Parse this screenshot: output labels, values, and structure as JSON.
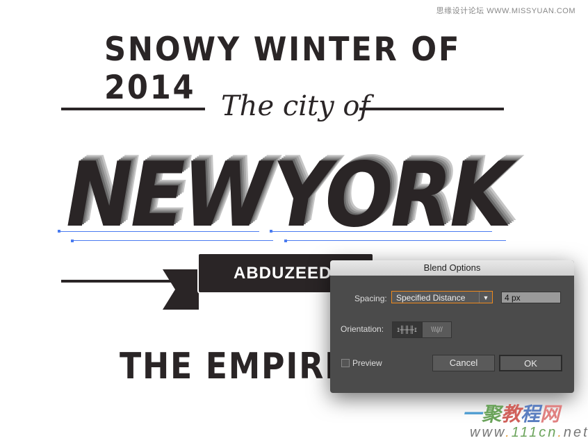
{
  "watermarks": {
    "top": "思缘设计论坛  WWW.MISSYUAN.COM",
    "bottom_cn": [
      "一",
      "聚",
      "教",
      "程",
      "网"
    ],
    "bottom_url_parts": [
      "www",
      ".",
      "111cn",
      ".",
      "net"
    ]
  },
  "artwork": {
    "title": "SNOWY WINTER OF 2014",
    "script": "The city of",
    "headline_left": "NEW",
    "headline_right": "YORK",
    "banner": "ABDUZEEDO",
    "bottom": "THE EMPIRE"
  },
  "dialog": {
    "title": "Blend Options",
    "spacing_label": "Spacing:",
    "spacing_value": "Specified Distance",
    "distance_value": "4 px",
    "orientation_label": "Orientation:",
    "orientation_options": [
      "align-to-page",
      "align-to-path"
    ],
    "orientation_selected": "align-to-page",
    "preview_label": "Preview",
    "preview_checked": false,
    "cancel_label": "Cancel",
    "ok_label": "OK",
    "accent_color": "#f08a1c"
  }
}
